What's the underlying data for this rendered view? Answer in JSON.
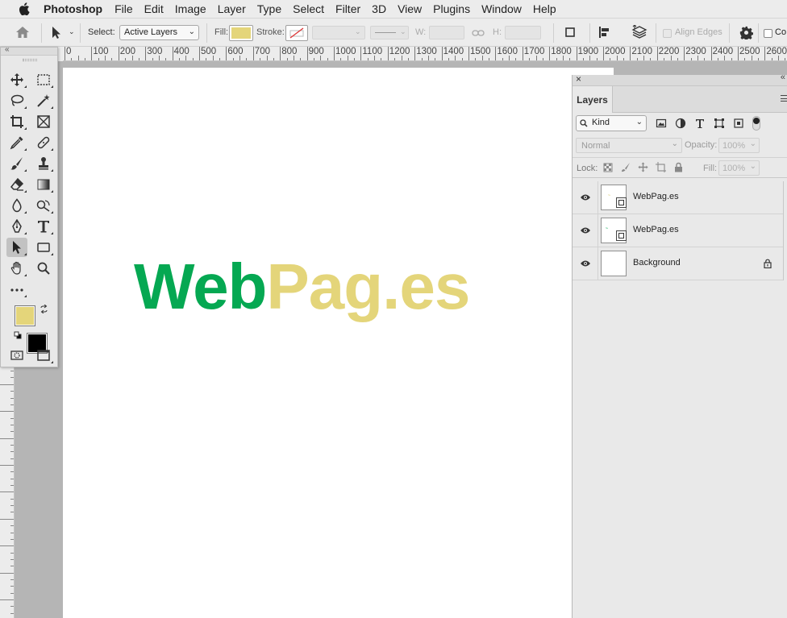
{
  "menubar": {
    "app_name": "Photoshop",
    "items": [
      "File",
      "Edit",
      "Image",
      "Layer",
      "Type",
      "Select",
      "Filter",
      "3D",
      "View",
      "Plugins",
      "Window",
      "Help"
    ]
  },
  "options_bar": {
    "select_label": "Select:",
    "select_value": "Active Layers",
    "fill_label": "Fill:",
    "fill_color": "#e4d57a",
    "stroke_label": "Stroke:",
    "w_label": "W:",
    "h_label": "H:",
    "align_edges_label": "Align Edges",
    "constrain_label": "Co"
  },
  "ruler": {
    "ticks": [
      "0",
      "100",
      "200",
      "300",
      "400",
      "500",
      "600",
      "700",
      "800",
      "900",
      "1000",
      "1100",
      "1200",
      "1300",
      "1400",
      "1500",
      "1600",
      "1700",
      "1800",
      "1900",
      "2000",
      "2100",
      "2200",
      "2300",
      "2400",
      "2500",
      "2600"
    ]
  },
  "canvas": {
    "word_green": "Web",
    "word_yellow": "Pag.es",
    "green_color": "#05a852",
    "yellow_color": "#e4d57a"
  },
  "toolbox": {
    "foreground_color": "#e4d57a",
    "background_color": "#000000"
  },
  "layers_panel": {
    "tab_label": "Layers",
    "filter_kind": "Kind",
    "blend_mode": "Normal",
    "opacity_label": "Opacity:",
    "opacity_value": "100%",
    "lock_label": "Lock:",
    "fill_label": "Fill:",
    "fill_value": "100%",
    "layers": [
      {
        "name": "WebPag.es",
        "type": "smart-object"
      },
      {
        "name": "WebPag.es",
        "type": "smart-object"
      },
      {
        "name": "Background",
        "type": "background",
        "locked": true
      }
    ]
  }
}
